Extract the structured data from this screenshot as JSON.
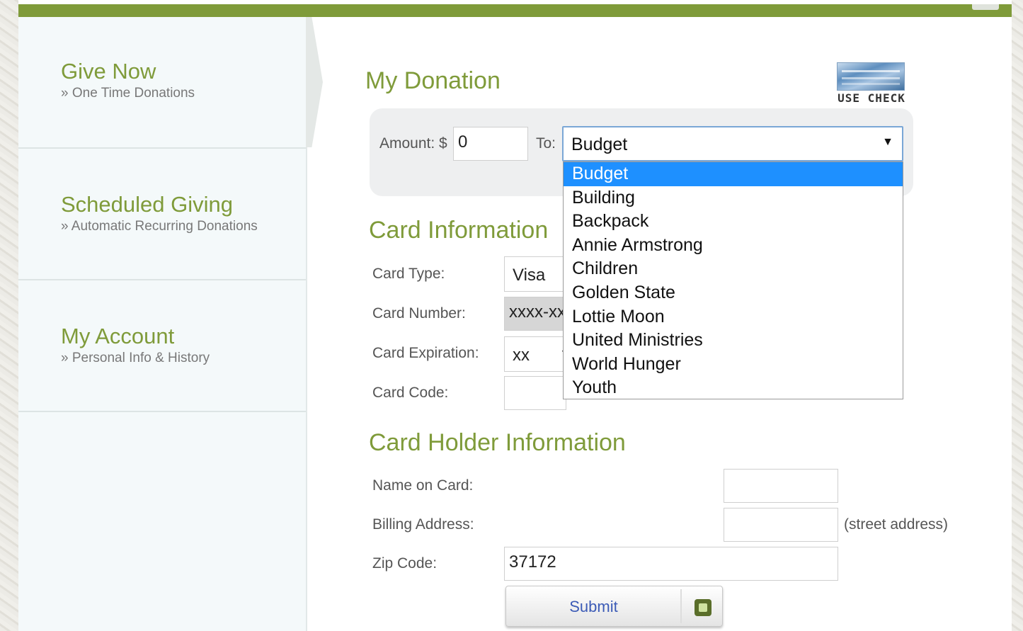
{
  "sidebar": {
    "items": [
      {
        "title": "Give Now",
        "subtitle": "» One Time Donations"
      },
      {
        "title": "Scheduled Giving",
        "subtitle": "» Automatic Recurring Donations"
      },
      {
        "title": "My Account",
        "subtitle": "» Personal Info & History"
      }
    ]
  },
  "donation": {
    "heading": "My Donation",
    "use_check_label": "USE CHECK",
    "amount_label": "Amount: $",
    "amount_value": "0",
    "to_label": "To:",
    "fund_selected": "Budget",
    "fund_options": [
      "Budget",
      "Building",
      "Backpack",
      "Annie Armstrong",
      "Children",
      "Golden State",
      "Lottie Moon",
      "United Ministries",
      "World Hunger",
      "Youth"
    ]
  },
  "card": {
    "heading": "Card Information",
    "type_label": "Card Type:",
    "type_value": "Visa",
    "number_label": "Card Number:",
    "number_value": "xxxx-xx",
    "expiration_label": "Card Expiration:",
    "expiration_value": "xx",
    "code_label": "Card Code:",
    "code_value": ""
  },
  "holder": {
    "heading": "Card Holder Information",
    "name_label": "Name on Card:",
    "name_value": "",
    "address_label": "Billing Address:",
    "address_value": "",
    "address_hint": "(street address)",
    "zip_label": "Zip Code:",
    "zip_value": "37172"
  },
  "submit_label": "Submit",
  "colors": {
    "brand_green": "#7f9b3a",
    "selection_blue": "#1e90ff",
    "link_blue": "#3c5bb6"
  }
}
